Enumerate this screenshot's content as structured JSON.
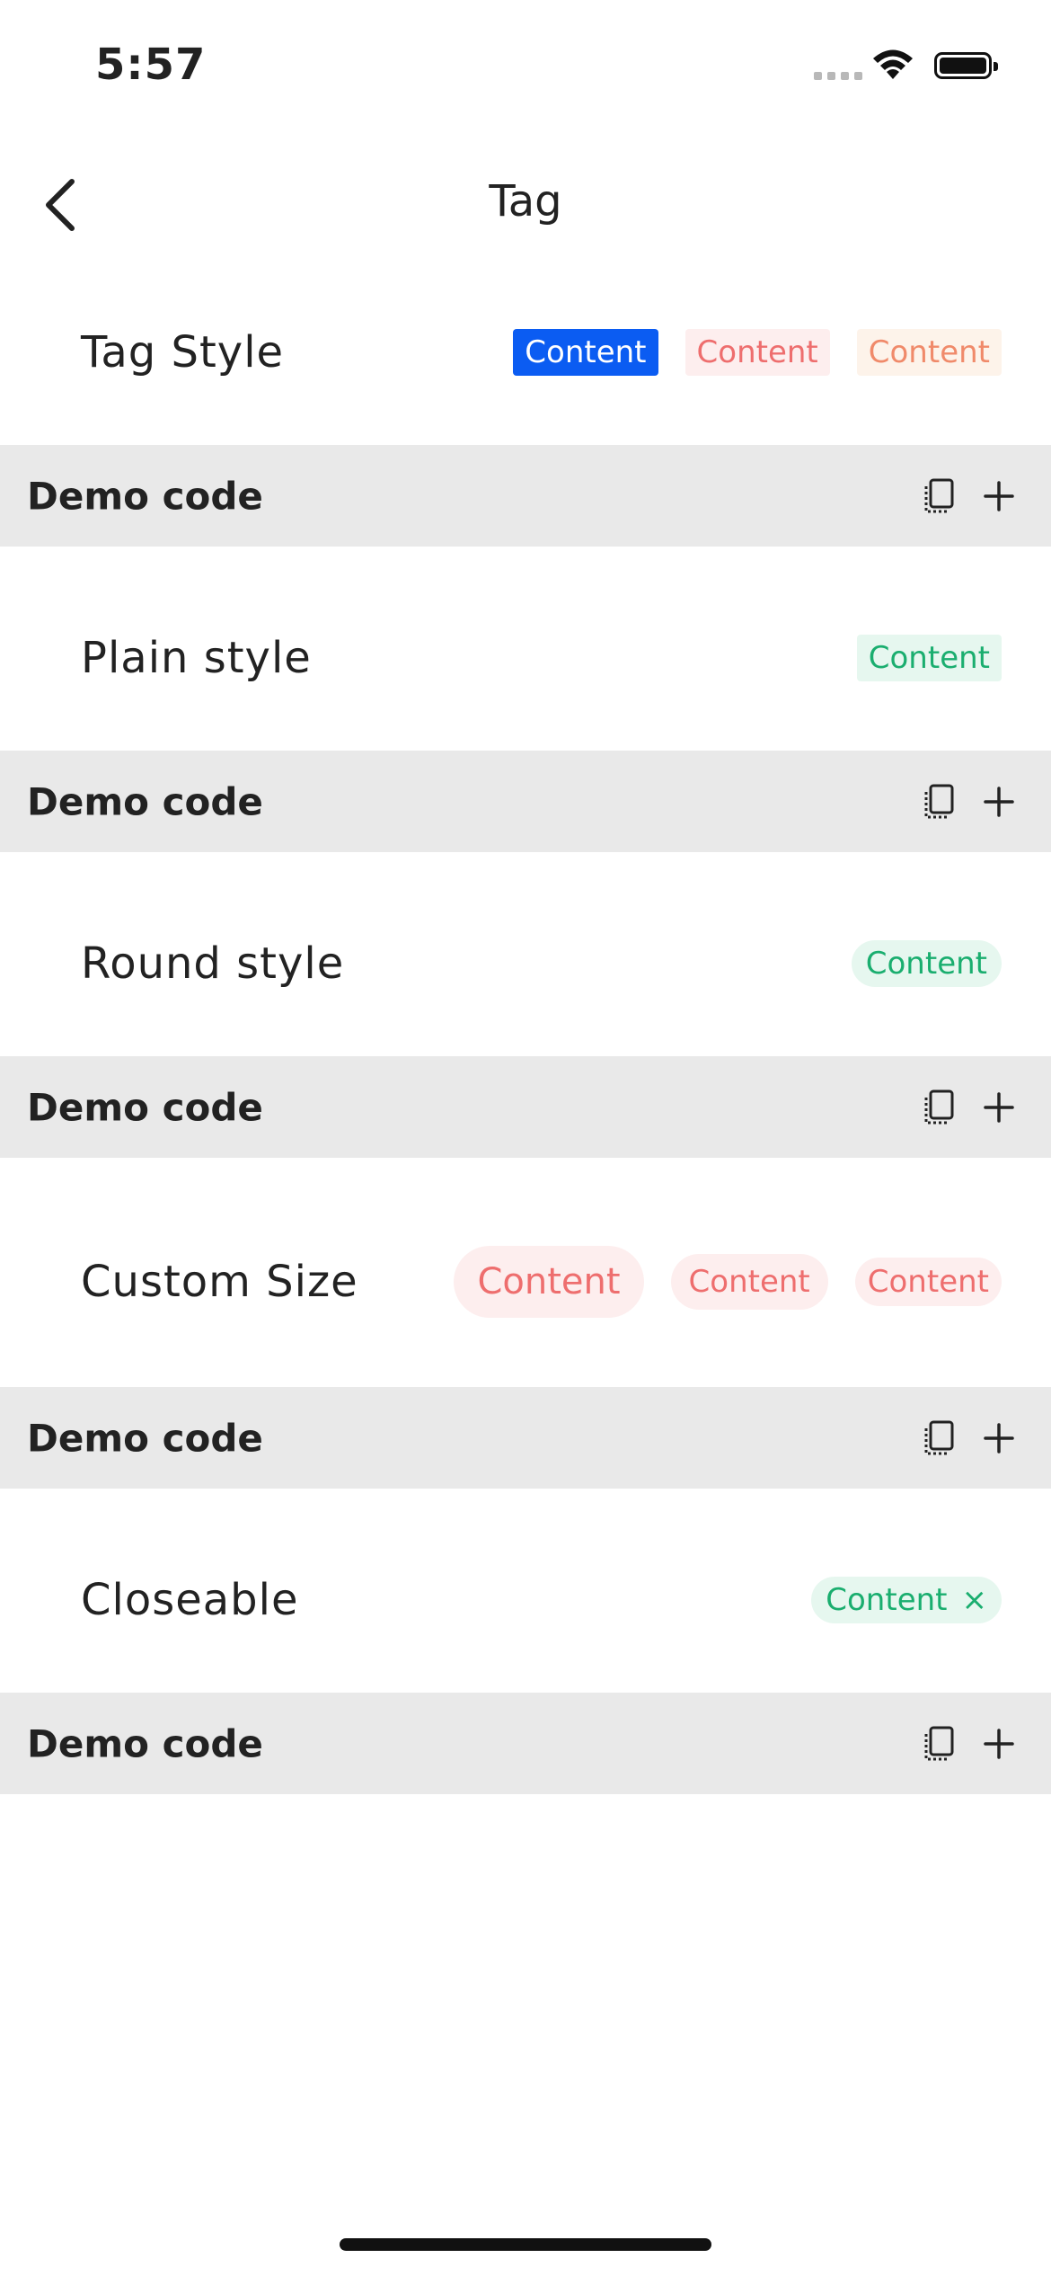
{
  "status_bar": {
    "time": "5:57"
  },
  "nav": {
    "title": "Tag"
  },
  "demo_code_label": "Demo code",
  "sections": [
    {
      "label": "Tag Style",
      "tags": [
        "Content",
        "Content",
        "Content"
      ]
    },
    {
      "label": "Plain style",
      "tags": [
        "Content"
      ]
    },
    {
      "label": "Round style",
      "tags": [
        "Content"
      ]
    },
    {
      "label": "Custom Size",
      "tags": [
        "Content",
        "Content",
        "Content"
      ]
    },
    {
      "label": "Closeable",
      "tags": [
        "Content"
      ],
      "close_glyph": "×"
    }
  ],
  "colors": {
    "primary": "#0b5cf2",
    "danger": "#ee6e6e",
    "warning": "#f08a6a",
    "success": "#1aae6f",
    "demo_bar": "#e9e9e9"
  },
  "icons": [
    "back-chevron-icon",
    "copy-icon",
    "plus-icon",
    "wifi-icon",
    "battery-icon",
    "signal-icon"
  ]
}
